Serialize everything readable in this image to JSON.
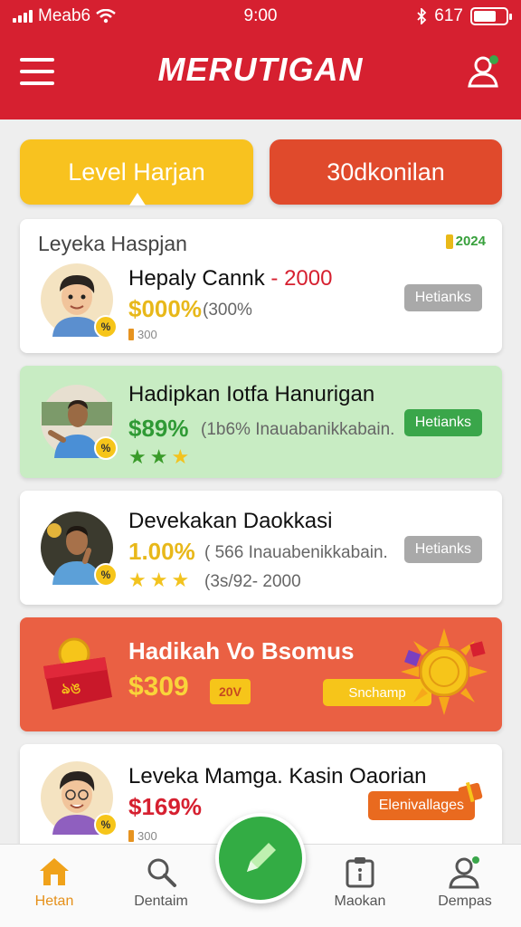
{
  "status_bar": {
    "carrier": "Meab6",
    "time": "9:00",
    "battery_text": "617"
  },
  "header": {
    "title": "MERUTIGAN",
    "menu_icon": "hamburger-icon",
    "profile_icon": "user-badge-icon"
  },
  "tabs": [
    {
      "label": "Level Harjan",
      "color": "#f8c21f"
    },
    {
      "label": "30dkonilan",
      "color": "#e04a2c"
    }
  ],
  "cards": [
    {
      "header": "Leyeka Haspjan",
      "year": "2024",
      "name": "Hepaly Cannk",
      "name_suffix": "- 2000",
      "percent": "$000%",
      "percent_color": "#e8b81a",
      "detail": "(300%",
      "note": "300",
      "button": "Hetianks",
      "coin_badge": "%"
    },
    {
      "name": "Hadipkan Iotfa Hanurigan",
      "percent": "$89%",
      "percent_color": "#2f9a35",
      "detail": "(1b6% Inauabanikkabain.",
      "stars": 3,
      "button": "Hetianks",
      "coin_badge": "%"
    },
    {
      "name": "Devekakan Daokkasi",
      "percent": "1.00%",
      "percent_color": "#e8b81a",
      "detail": "( 566 Inauabenikkabain.",
      "stars_detail": "(3s/92- 2000",
      "stars": 3,
      "button": "Hetianks",
      "coin_badge": "%"
    },
    {
      "promo_title": "Hadikah Vo Bsomus",
      "amount": "$309",
      "mini_tag": "20V",
      "cta": "Snchamp"
    },
    {
      "name": "Leveka Mamga. Kasin Oaorian",
      "percent": "$169%",
      "percent_color": "#d62030",
      "note": "300",
      "button": "Elenivallages",
      "coin_badge": "%"
    }
  ],
  "bottom_nav": [
    {
      "label": "Hetan",
      "icon": "home-icon",
      "active": true
    },
    {
      "label": "Dentaim",
      "icon": "search-icon",
      "active": false
    },
    {
      "label": "Maokan",
      "icon": "clipboard-icon",
      "active": false
    },
    {
      "label": "Dempas",
      "icon": "profile-icon",
      "active": false
    }
  ],
  "fab_icon": "edit-icon",
  "colors": {
    "primary_red": "#d62030",
    "yellow": "#f8c21f",
    "green_card": "#c8ecc3",
    "orange_card": "#ea6043",
    "fab_green": "#33ac44"
  }
}
